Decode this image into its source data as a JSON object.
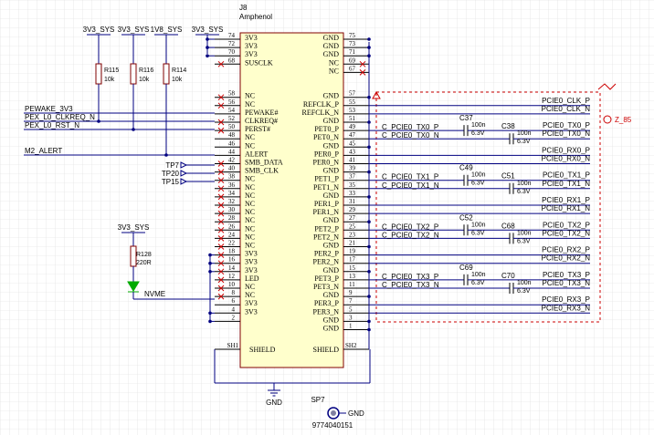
{
  "component": {
    "ref": "J8",
    "manufacturer": "Amphenol",
    "left_names": [
      "3V3",
      "3V3",
      "3V3",
      "SUSCLK",
      "NC",
      "NC",
      "PEWAKE#",
      "CLKREQ#",
      "PERST#",
      "NC",
      "NC",
      "ALERT",
      "SMB_DATA",
      "SMB_CLK",
      "NC",
      "NC",
      "NC",
      "NC",
      "NC",
      "NC",
      "NC",
      "NC",
      "NC",
      "3V3",
      "3V3",
      "3V3",
      "LED",
      "NC",
      "NC",
      "3V3",
      "3V3"
    ],
    "left_nums": [
      "74",
      "72",
      "70",
      "68",
      "58",
      "56",
      "54",
      "52",
      "50",
      "48",
      "46",
      "44",
      "42",
      "40",
      "38",
      "36",
      "34",
      "32",
      "30",
      "28",
      "26",
      "24",
      "22",
      "18",
      "16",
      "14",
      "12",
      "10",
      "8",
      "6",
      "4",
      "2"
    ],
    "right_names": [
      "GND",
      "GND",
      "GND",
      "NC",
      "NC",
      "GND",
      "REFCLK_P",
      "REFCLK_N",
      "GND",
      "PET0_P",
      "PET0_N",
      "GND",
      "PER0_P",
      "PER0_N",
      "GND",
      "PET1_P",
      "PET1_N",
      "GND",
      "PER1_P",
      "PER1_N",
      "GND",
      "PET2_P",
      "PET2_N",
      "GND",
      "PER2_P",
      "PER2_N",
      "GND",
      "PET3_P",
      "PET3_N",
      "GND",
      "PER3_P",
      "PER3_N",
      "GND",
      "GND"
    ],
    "right_nums": [
      "75",
      "73",
      "71",
      "69",
      "67",
      "57",
      "55",
      "53",
      "51",
      "49",
      "47",
      "45",
      "43",
      "41",
      "39",
      "37",
      "35",
      "33",
      "31",
      "29",
      "27",
      "25",
      "23",
      "21",
      "19",
      "17",
      "15",
      "13",
      "11",
      "9",
      "7",
      "5",
      "3",
      "1"
    ],
    "shield_left_pin": "SH1",
    "shield_left_name": "SHIELD",
    "shield_right_pin": "SH2",
    "shield_right_name": "SHIELD"
  },
  "power_labels": [
    "3V3_SYS",
    "3V3_SYS",
    "1V8_SYS",
    "3V3_SYS"
  ],
  "resistors": [
    {
      "ref": "R115",
      "value": "10k"
    },
    {
      "ref": "R116",
      "value": "10k"
    },
    {
      "ref": "R114",
      "value": "10k"
    }
  ],
  "left_nets": [
    "PEWAKE_3V3",
    "PEX_L0_CLKREQ_N",
    "PEX_L0_RST_N",
    "M2_ALERT"
  ],
  "test_points": [
    "TP7",
    "TP20",
    "TP15"
  ],
  "led": {
    "power": "3V3_SYS",
    "resistor": "R128",
    "value": "220R",
    "net": "NVME"
  },
  "right_nets": [
    "PCIE0_CLK_P",
    "PCIE0_CLK_N",
    "C_PCIE0_TX0_P",
    "C_PCIE0_TX0_N",
    "PCIE0_TX0_P",
    "PCIE0_TX0_N",
    "PCIE0_RX0_P",
    "PCIE0_RX0_N",
    "C_PCIE0_TX1_P",
    "C_PCIE0_TX1_N",
    "PCIE0_TX1_P",
    "PCIE0_TX1_N",
    "PCIE0_RX1_P",
    "PCIE0_RX1_N",
    "C_PCIE0_TX2_P",
    "C_PCIE0_TX2_N",
    "PCIE0_TX2_P",
    "PCIE0_TX2_N",
    "PCIE0_RX2_P",
    "PCIE0_RX2_N",
    "C_PCIE0_TX3_P",
    "C_PCIE0_TX3_N",
    "PCIE0_TX3_P",
    "PCIE0_TX3_N",
    "PCIE0_RX3_P",
    "PCIE0_RX3_N"
  ],
  "capacitors": [
    {
      "ref": "C37",
      "value": "100n",
      "voltage": "6.3V"
    },
    {
      "ref": "C38",
      "value": "100n",
      "voltage": "6.3V"
    },
    {
      "ref": "C49",
      "value": "100n",
      "voltage": "6.3V"
    },
    {
      "ref": "C51",
      "value": "100n",
      "voltage": "6.3V"
    },
    {
      "ref": "C52",
      "value": "100n",
      "voltage": "6.3V"
    },
    {
      "ref": "C68",
      "value": "100n",
      "voltage": "6.3V"
    },
    {
      "ref": "C69",
      "value": "100n",
      "voltage": "6.3V"
    },
    {
      "ref": "C70",
      "value": "100n",
      "voltage": "6.3V"
    }
  ],
  "diff_pair": "Z_85",
  "gnd": [
    "GND",
    "GND"
  ],
  "standoff": {
    "ref": "SP7",
    "part": "9774040151"
  },
  "colors": {
    "wire": "#000080",
    "body": "#ffffcc",
    "body_stroke": "#800000",
    "text": "#000000",
    "rule": "#8b0000",
    "grid": "#d9d9d9",
    "led": "#00aa00"
  }
}
